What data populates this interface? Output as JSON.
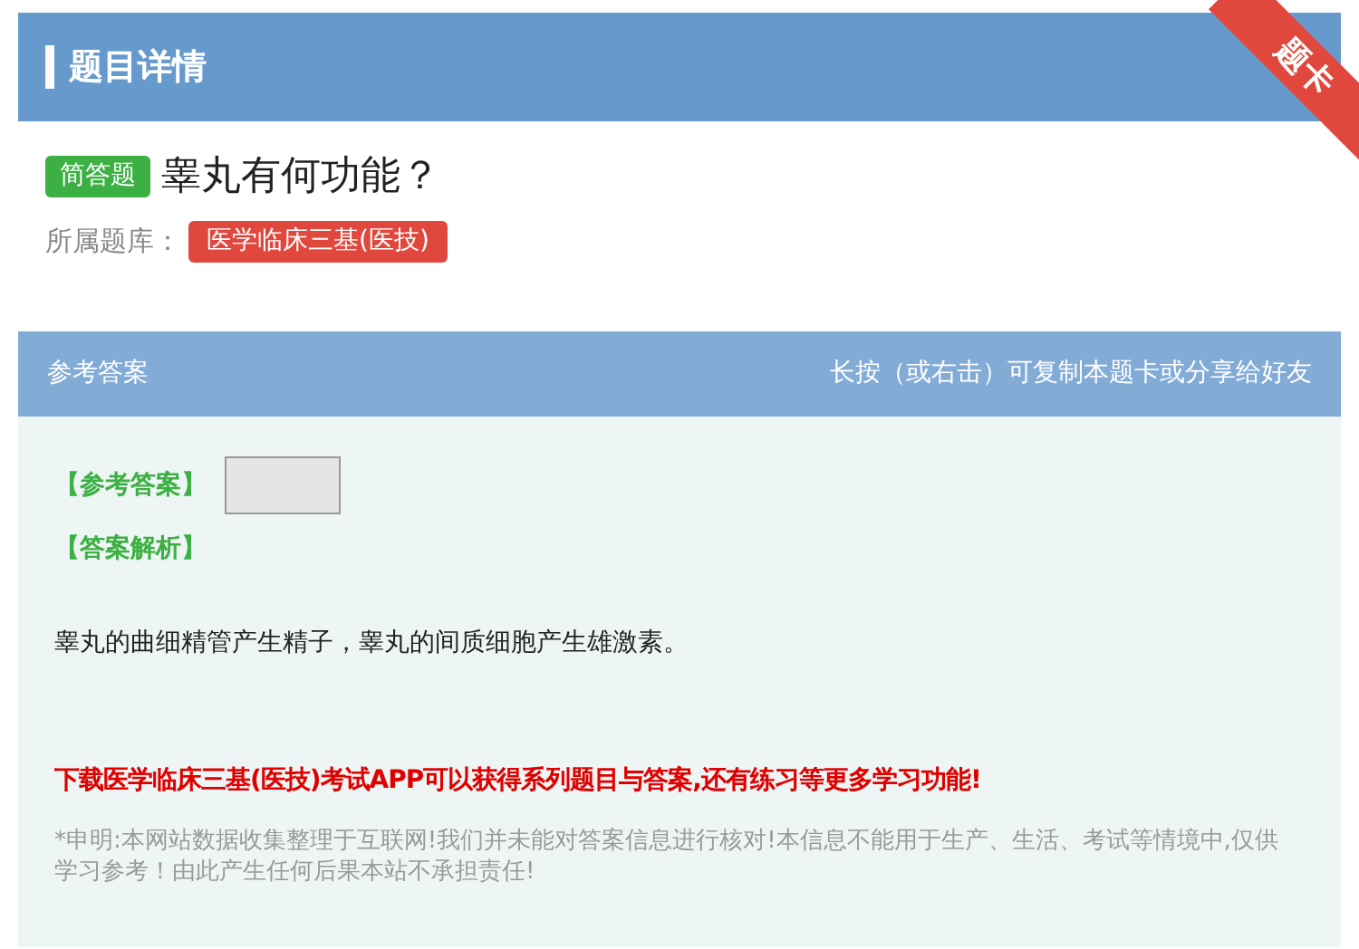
{
  "header": {
    "title": "题目详情",
    "ribbon": "题卡"
  },
  "question": {
    "type_tag": "简答题",
    "text": "睾丸有何功能？",
    "bank_label": "所属题库：",
    "bank": "医学临床三基(医技)"
  },
  "answer_panel": {
    "title": "参考答案",
    "hint": "长按（或右击）可复制本题卡或分享给好友",
    "answer_label": "【参考答案】",
    "analysis_label": "【答案解析】",
    "analysis": "睾丸的曲细精管产生精子，睾丸的间质细胞产生雄激素。",
    "promo": "下载医学临床三基(医技)考试APP可以获得系列题目与答案,还有练习等更多学习功能!",
    "disclaimer": "*申明:本网站数据收集整理于互联网!我们并未能对答案信息进行核对!本信息不能用于生产、生活、考试等情境中,仅供学习参考！由此产生任何后果本站不承担责任!"
  }
}
